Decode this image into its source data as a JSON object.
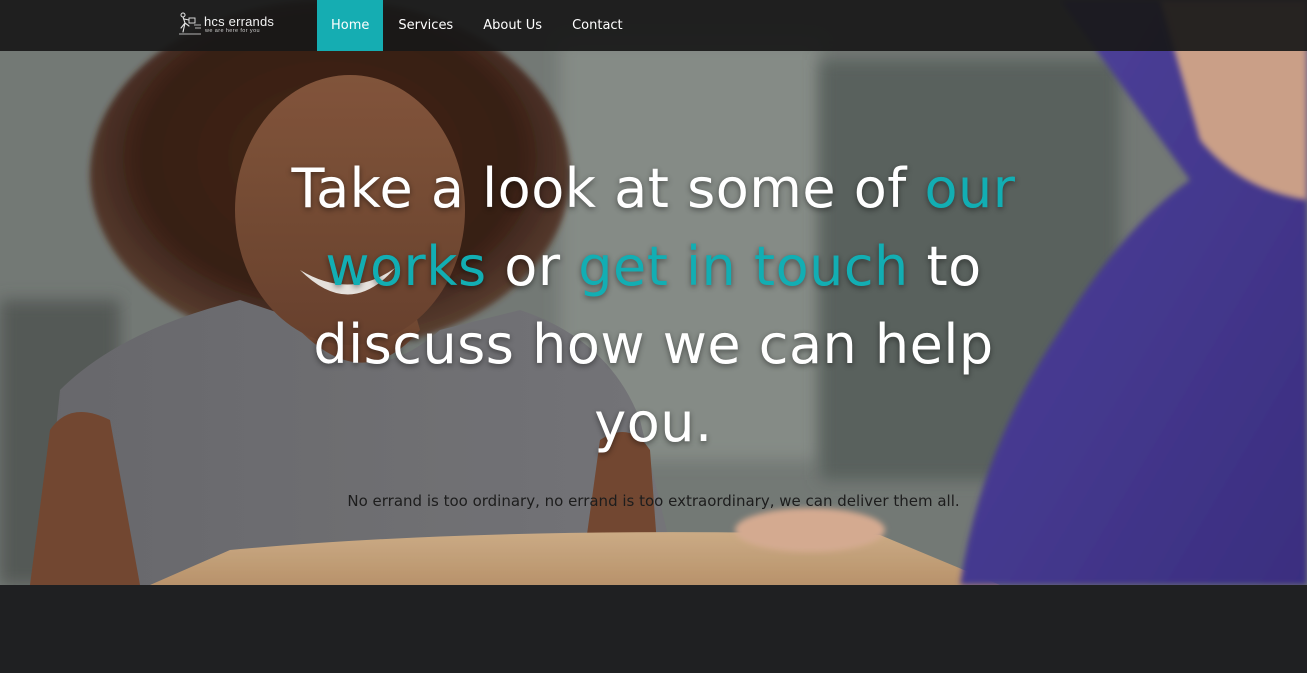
{
  "brand": {
    "name": "hcs errands",
    "tagline": "we are here for you",
    "logo_icon": "runner-with-package-icon"
  },
  "nav": {
    "items": [
      {
        "label": "Home",
        "active": true
      },
      {
        "label": "Services",
        "active": false
      },
      {
        "label": "About Us",
        "active": false
      },
      {
        "label": "Contact",
        "active": false
      }
    ]
  },
  "hero": {
    "headline_part1": "Take a look at some of ",
    "headline_link1": "our works",
    "headline_part2": " or ",
    "headline_link2": "get in touch",
    "headline_part3": " to discuss how we can help you.",
    "subtext": "No errand is too ordinary, no errand is too extraordinary, we can deliver them all."
  },
  "colors": {
    "accent": "#12aeb3",
    "navbar": "#181818",
    "dark_band": "#1f2022",
    "text_light": "#ffffff"
  }
}
